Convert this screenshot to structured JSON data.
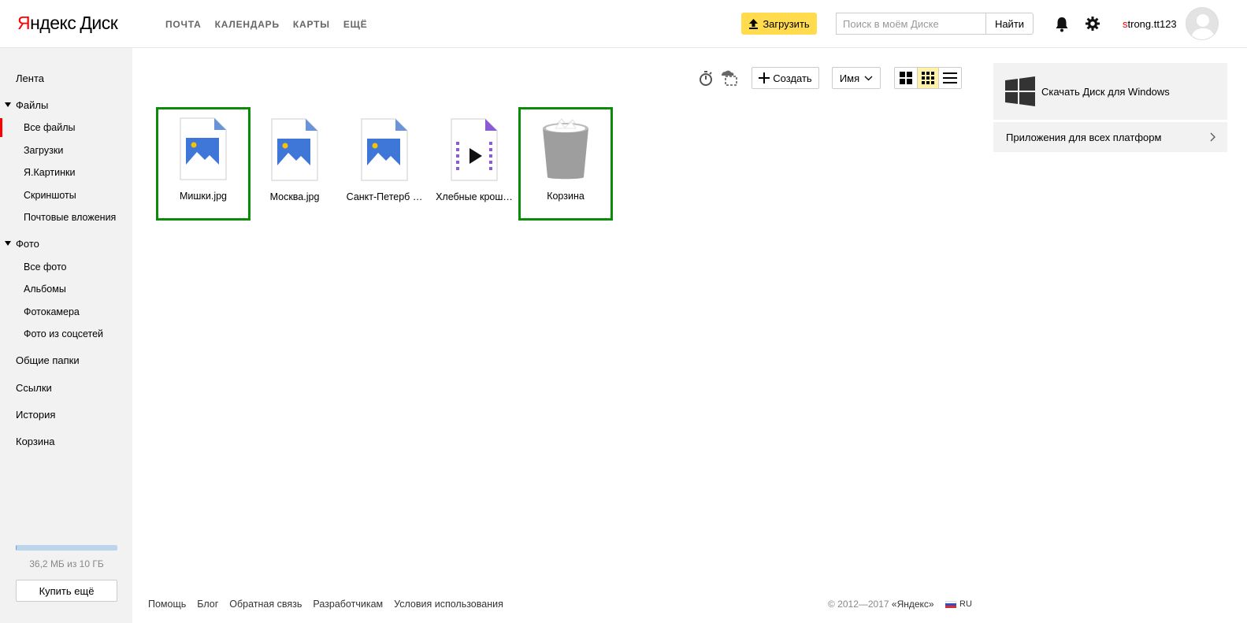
{
  "header": {
    "logo_prefix": "Я",
    "logo_rest": "ндекс",
    "logo_product": "Диск",
    "nav": [
      "ПОЧТА",
      "КАЛЕНДАРЬ",
      "КАРТЫ",
      "ЕЩЁ"
    ],
    "upload_label": "Загрузить",
    "search_placeholder": "Поиск в моём Диске",
    "search_button": "Найти",
    "username_first": "s",
    "username_rest": "trong.tt123"
  },
  "sidebar": {
    "feed": "Лента",
    "files_section": "Файлы",
    "files_items": [
      "Все файлы",
      "Загрузки",
      "Я.Картинки",
      "Скриншоты",
      "Почтовые вложения"
    ],
    "photo_section": "Фото",
    "photo_items": [
      "Все фото",
      "Альбомы",
      "Фотокамера",
      "Фото из соцсетей"
    ],
    "shared": "Общие папки",
    "links": "Ссылки",
    "history": "История",
    "trash": "Корзина",
    "quota_text": "36,2 МБ из 10 ГБ",
    "quota_fraction": 0.0035,
    "buy_label": "Купить ещё"
  },
  "toolbar": {
    "create_label": "Создать",
    "sort_label": "Имя"
  },
  "files": [
    {
      "name": "Мишки.jpg",
      "type": "image",
      "selected": true
    },
    {
      "name": "Москва.jpg",
      "type": "image",
      "selected": false
    },
    {
      "name": "Санкт-Петерб …",
      "type": "image",
      "selected": false
    },
    {
      "name": "Хлебные крош…",
      "type": "video",
      "selected": false
    },
    {
      "name": "Корзина",
      "type": "trash",
      "selected": true
    }
  ],
  "right_panel": {
    "download_label": "Скачать Диск для Windows",
    "apps_label": "Приложения для всех платформ"
  },
  "footer": {
    "links": [
      "Помощь",
      "Блог",
      "Обратная связь",
      "Разработчикам",
      "Условия использования"
    ],
    "copyright": "© 2012—2017 ",
    "copyright_company": "«Яндекс»",
    "lang": "RU"
  },
  "colors": {
    "accent_yellow": "#ffdb4d",
    "selection_green": "#0b8a0b",
    "active_red": "#ff0000",
    "image_icon_blue": "#3f77d8",
    "video_icon_purple": "#8b5bd6"
  }
}
